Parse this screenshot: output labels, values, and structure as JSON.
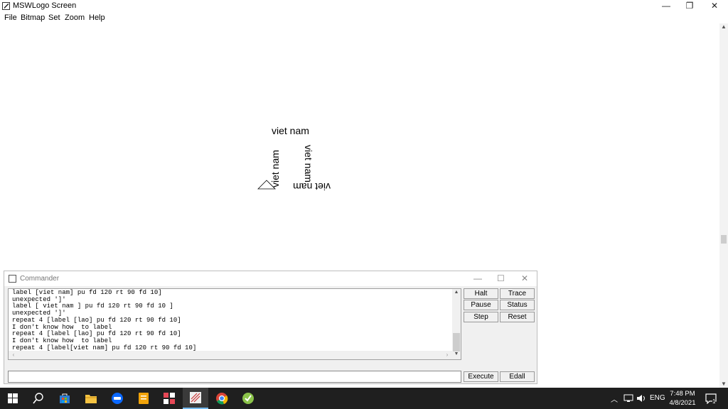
{
  "window": {
    "title": "MSWLogo Screen",
    "minimize_glyph": "—",
    "maximize_glyph": "❐",
    "close_glyph": "✕"
  },
  "menu": [
    "File",
    "Bitmap",
    "Set",
    "Zoom",
    "Help"
  ],
  "canvas": {
    "labels": [
      "viet nam",
      "viet nam",
      "viet nam",
      "viet nam"
    ],
    "turtle_icon": "triangle-turtle-icon"
  },
  "commander": {
    "title": "Commander",
    "minimize_glyph": "—",
    "maximize_glyph": "☐",
    "close_glyph": "✕",
    "history": [
      "label [viet nam] pu fd 120 rt 90 fd 10]",
      "unexpected ']'",
      "label [ viet nam ] pu fd 120 rt 90 fd 10 ]",
      "unexpected ']'",
      "repeat 4 [label [lao] pu fd 120 rt 90 fd 10]",
      "I don't know how  to label",
      "repeat 4 [label [lao] pu fd 120 rt 90 fd 10]",
      "I don't know how  to label",
      "repeat 4 [label[viet nam] pu fd 120 rt 90 fd 10]"
    ],
    "input_value": "",
    "buttons": {
      "halt": "Halt",
      "trace": "Trace",
      "pause": "Pause",
      "status": "Status",
      "step": "Step",
      "reset": "Reset",
      "execute": "Execute",
      "edall": "Edall"
    }
  },
  "taskbar": {
    "apps": [
      "start-icon",
      "search-icon",
      "store-icon",
      "file-explorer-icon",
      "zalo-icon",
      "sticky-notes-icon",
      "app-grid-icon",
      "mswlogo-icon",
      "chrome-icon",
      "green-app-icon"
    ],
    "tray": {
      "language": "ENG",
      "time": "7:48 PM",
      "date": "4/8/2021",
      "notification_count": "1"
    }
  }
}
